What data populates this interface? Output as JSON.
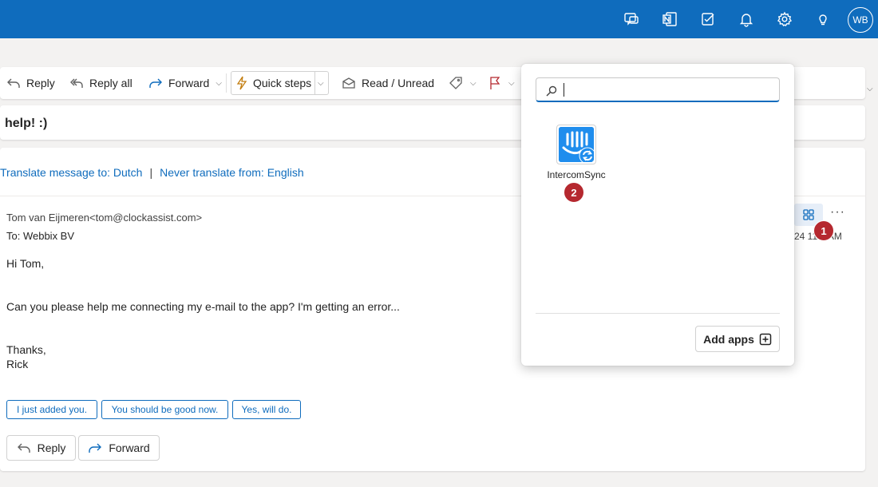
{
  "header": {
    "avatar_initials": "WB",
    "icons": [
      "chat-icon",
      "onenote-icon",
      "tasks-icon",
      "bell-icon",
      "gear-icon",
      "lightbulb-icon"
    ],
    "bg_color": "#0f6cbd"
  },
  "toolbar": {
    "reply": "Reply",
    "reply_all": "Reply all",
    "forward": "Forward",
    "quick_steps": "Quick steps",
    "read_unread": "Read / Unread"
  },
  "subject": "help! :)",
  "translate": {
    "translate_to": "Translate message to: Dutch",
    "separator": "|",
    "never_translate": "Never translate from: English"
  },
  "message": {
    "from": "Tom van Eijmeren<tom@clockassist.com>",
    "to": "To:  Webbix BV",
    "time": "24 11:1   AM",
    "body": {
      "greeting": "Hi Tom,",
      "line1": "Can you please help me connecting my e-mail to the app? I'm getting an error...",
      "closing": "Thanks,",
      "signature": "Rick"
    },
    "more": "···"
  },
  "suggested_replies": [
    "I just added you.",
    "You should be good now.",
    "Yes, will do."
  ],
  "actions": {
    "reply": "Reply",
    "forward": "Forward"
  },
  "popup": {
    "search_value": "",
    "search_placeholder": "",
    "apps": [
      {
        "name": "IntercomSync",
        "icon": "intercom-sync-icon",
        "color": "#1f8ded"
      }
    ],
    "add_apps": "Add apps"
  },
  "badges": {
    "one": "1",
    "two": "2",
    "color": "#b5282f"
  }
}
